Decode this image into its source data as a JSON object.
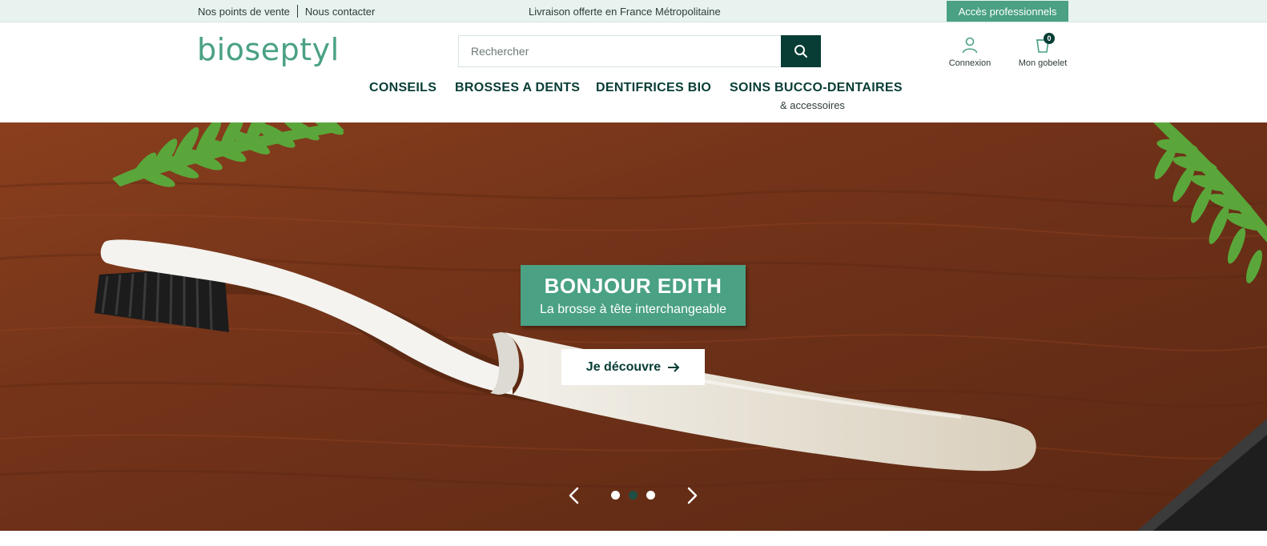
{
  "topbar": {
    "store_locator": "Nos points de vente",
    "contact": "Nous contacter",
    "promo": "Livraison offerte en France Métropolitaine",
    "pro_access": "Accès professionnels"
  },
  "header": {
    "logo": "bioseptyl",
    "search_placeholder": "Rechercher",
    "account_label": "Connexion",
    "cart_label": "Mon gobelet",
    "cart_count": "0"
  },
  "nav": {
    "items": [
      {
        "label": "CONSEILS"
      },
      {
        "label": "BROSSES A DENTS"
      },
      {
        "label": "DENTIFRICES BIO"
      },
      {
        "label": "SOINS BUCCO-DENTAIRES",
        "sub": "& accessoires"
      }
    ]
  },
  "hero": {
    "title": "BONJOUR EDITH",
    "subtitle": "La brosse à tête interchangeable",
    "cta": "Je découvre",
    "slides": 3,
    "active_slide": 2
  },
  "colors": {
    "brand_green": "#4aa184",
    "dark_green": "#073d35",
    "topbar_bg": "#e8f2ef"
  },
  "icons": {
    "search": "search-icon",
    "account": "user-icon",
    "cart": "cup-icon",
    "prev": "chevron-left-icon",
    "next": "chevron-right-icon",
    "cta_arrow": "arrow-right-icon"
  }
}
